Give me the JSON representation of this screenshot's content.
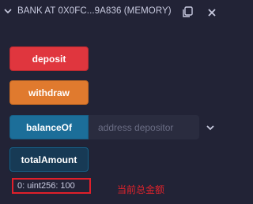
{
  "header": {
    "title": "BANK AT 0X0FC...9A836 (MEMORY)",
    "copy_icon": "copy-icon",
    "close_icon": "close-icon",
    "collapse_icon": "chevron-down-icon"
  },
  "buttons": {
    "deposit": "deposit",
    "withdraw": "withdraw",
    "balanceOf": "balanceOf",
    "totalAmount": "totalAmount"
  },
  "balanceOf_input": {
    "placeholder": "address depositor",
    "value": ""
  },
  "result": {
    "text": "0: uint256: 100"
  },
  "annotation": {
    "text": "当前总金额"
  },
  "colors": {
    "background": "#222336",
    "deposit": "#e0363e",
    "withdraw": "#e07a2e",
    "call": "#1c6e99",
    "annotation": "#e4232b"
  }
}
